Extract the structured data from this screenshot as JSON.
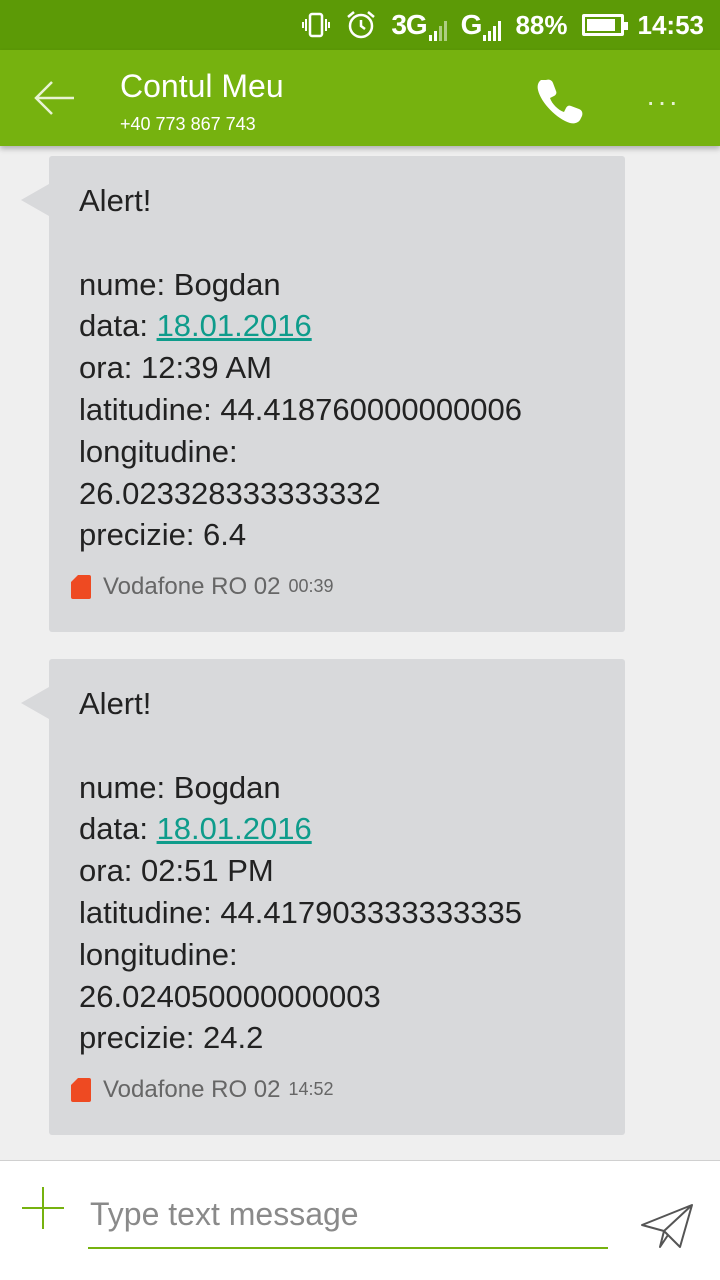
{
  "status_bar": {
    "network_3g": "3G",
    "network_g": "G",
    "battery_percent": "88%",
    "battery_level": 0.88,
    "time": "14:53",
    "icons": [
      "vibrate-icon",
      "alarm-icon",
      "signal-icon",
      "battery-icon"
    ]
  },
  "app_bar": {
    "title": "Contul Meu",
    "subtitle": "+40 773 867 743",
    "more_label": "···",
    "colors": {
      "app_bar": "#76b20f",
      "status_bar": "#5c9a06"
    }
  },
  "messages": [
    {
      "lines": [
        "Alert!",
        "",
        "nume: Bogdan"
      ],
      "date_prefix": "data: ",
      "date_link": "18.01.2016",
      "lines_after": [
        "ora: 12:39 AM",
        "latitudine: 44.418760000000006",
        "longitudine:",
        "26.023328333333332",
        "precizie: 6.4"
      ],
      "sender": "Vodafone RO 02",
      "time": "00:39"
    },
    {
      "lines": [
        "Alert!",
        "",
        "nume: Bogdan"
      ],
      "date_prefix": "data: ",
      "date_link": "18.01.2016",
      "lines_after": [
        "ora: 02:51 PM",
        "latitudine: 44.417903333333335",
        "longitudine:",
        "26.024050000000003",
        "precizie: 24.2"
      ],
      "sender": "Vodafone RO 02",
      "time": "14:52"
    }
  ],
  "composer": {
    "placeholder": "Type text message"
  }
}
